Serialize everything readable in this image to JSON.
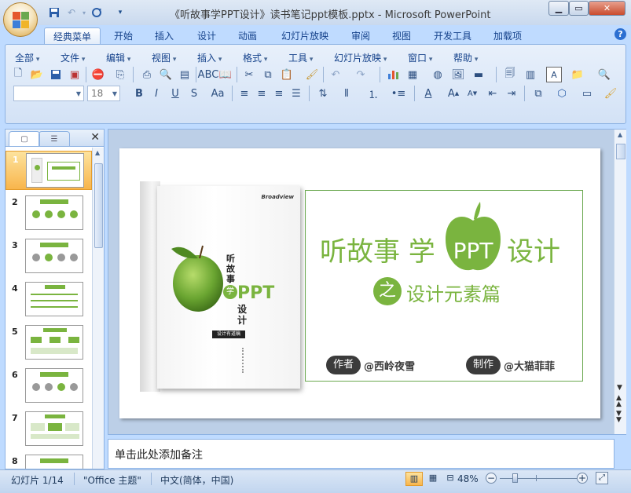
{
  "window": {
    "title": "《听故事学PPT设计》读书笔记ppt模板.pptx - Microsoft PowerPoint"
  },
  "ribbon_tabs": [
    "经典菜单",
    "开始",
    "插入",
    "设计",
    "动画",
    "幻灯片放映",
    "审阅",
    "视图",
    "开发工具",
    "加载项"
  ],
  "active_tab": "经典菜单",
  "menus": [
    "全部",
    "文件",
    "编辑",
    "视图",
    "插入",
    "格式",
    "工具",
    "幻灯片放映",
    "窗口",
    "帮助"
  ],
  "toolbar": {
    "font_name": "",
    "font_size": "18",
    "font_color": "#c0504d",
    "fill_color": "#f0c040"
  },
  "slides_panel": {
    "slide_numbers": [
      "1",
      "2",
      "3",
      "4",
      "5",
      "6",
      "7",
      "8"
    ],
    "selected": "1"
  },
  "slide": {
    "title_part1": "听故事 学",
    "title_apple": "PPT",
    "title_part2": "设计",
    "sub_circle": "之",
    "subtitle": "设计元素篇",
    "author_label": "作者",
    "author_name": "@西岭夜雪",
    "maker_label": "制作",
    "maker_name": "@大猫菲菲",
    "accent_color": "#7ab43f",
    "book": {
      "publisher_logo": "Broadview",
      "vertical_title": "听故事",
      "vertical_title2": "学",
      "cover_ppt": "PPT",
      "cover_design": "设计",
      "badge": "设计有道稿"
    }
  },
  "notes": {
    "placeholder": "单击此处添加备注"
  },
  "status": {
    "slide_info": "幻灯片 1/14",
    "theme": "\"Office 主题\"",
    "language": "中文(简体，中国)",
    "zoom": "48%"
  }
}
